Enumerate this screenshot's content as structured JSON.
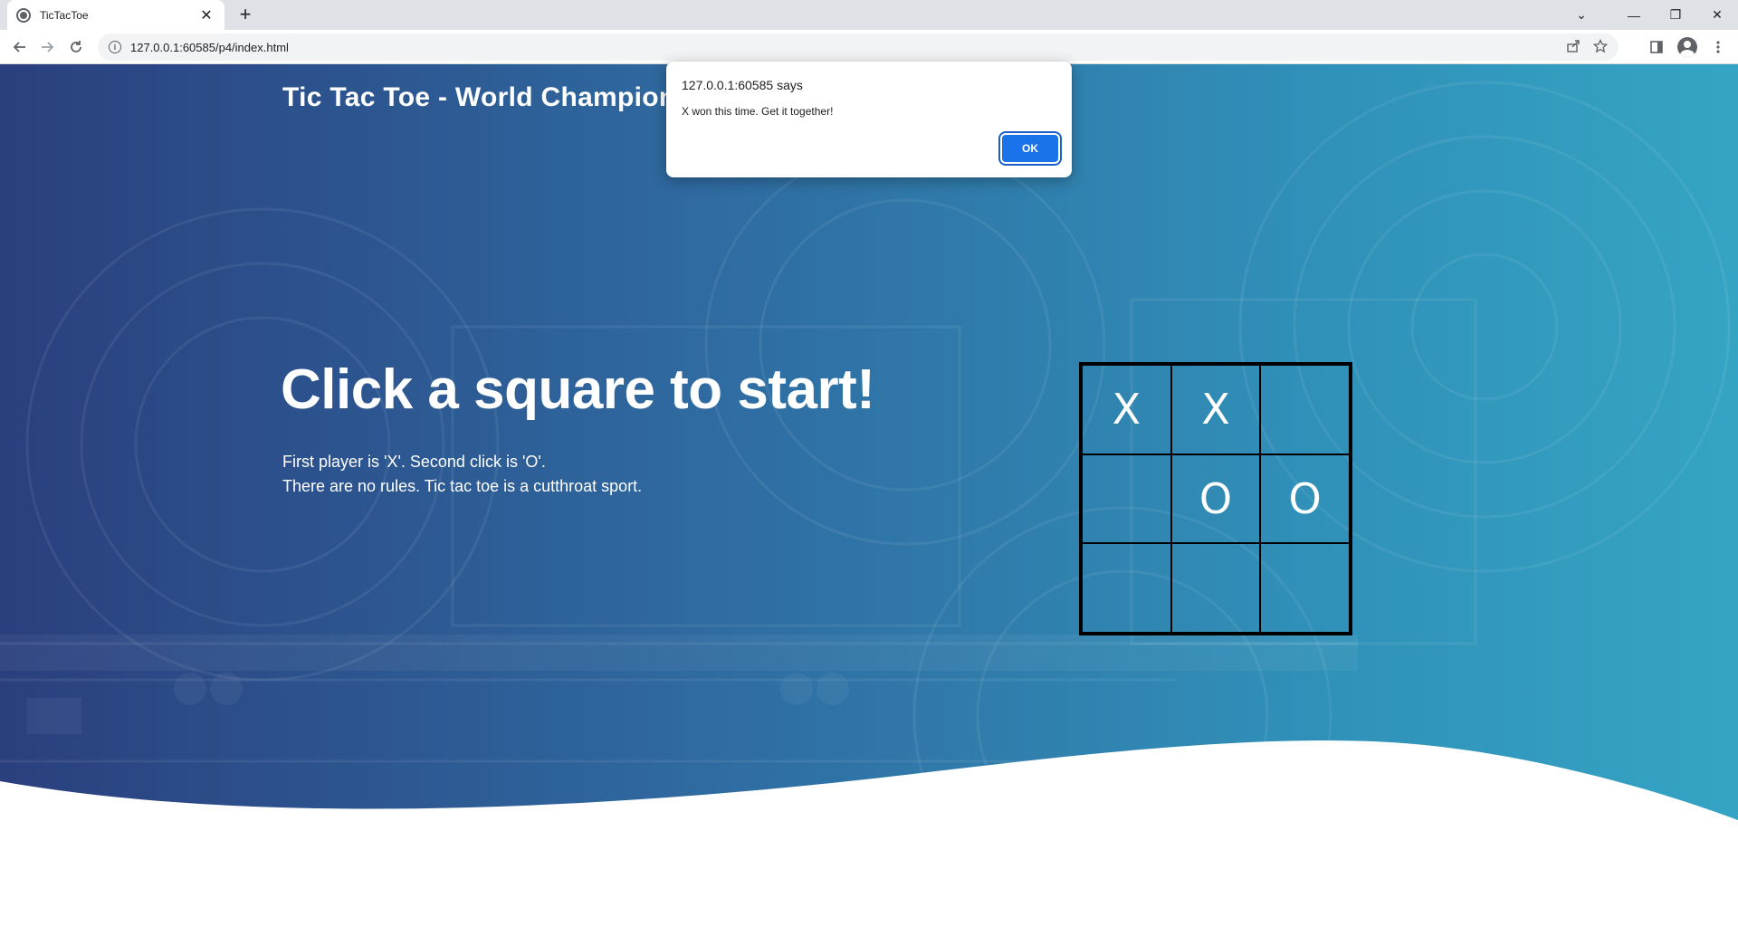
{
  "browser": {
    "tab_title": "TicTacToe",
    "tab_close": "✕",
    "new_tab": "+",
    "url": "127.0.0.1:60585/p4/index.html",
    "icons": [
      "back-icon",
      "forward-icon",
      "reload-icon",
      "site-info-icon",
      "share-icon",
      "bookmark-star-icon",
      "side-panel-icon",
      "profile-icon",
      "menu-icon"
    ],
    "window_controls": {
      "minimize": "—",
      "restore": "❐",
      "close": "✕",
      "tab_search": "⌄"
    }
  },
  "page": {
    "brand": "Tic Tac Toe - World Championship",
    "headline": "Click a square to start!",
    "subtext_line1": "First player is 'X'. Second click is 'O'.",
    "subtext_line2": "There are no rules. Tic tac toe is a cutthroat sport.",
    "board": [
      "X",
      "X",
      "",
      "",
      "O",
      "O",
      "",
      "",
      ""
    ],
    "colors": {
      "gradient_start": "#2a3f7e",
      "gradient_end": "#35a4c4",
      "text": "#ffffff",
      "grid": "#000000"
    }
  },
  "dialog": {
    "origin": "127.0.0.1:60585 says",
    "message": "X won this time. Get it together!",
    "ok_label": "OK",
    "accent": "#1a73e8"
  }
}
